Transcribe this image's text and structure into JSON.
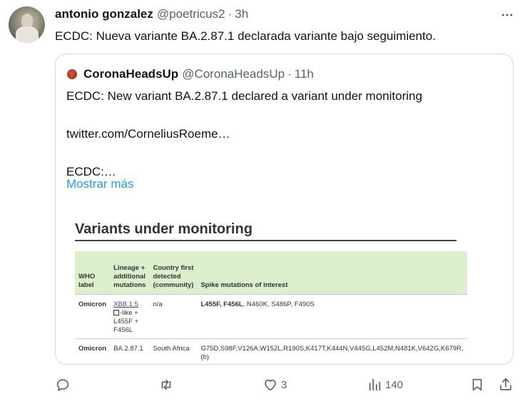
{
  "tweet": {
    "author_name": "antonio gonzalez",
    "author_handle": "@poetricus2",
    "separator": "·",
    "time": "3h",
    "text": "ECDC: Nueva variante BA.2.87.1 declarada variante bajo seguimiento."
  },
  "quoted": {
    "author_name": "CoronaHeadsUp",
    "author_handle": "@CoronaHeadsUp",
    "separator": "·",
    "time": "11h",
    "lines": [
      "ECDC: New variant BA.2.87.1 declared a variant under monitoring",
      "",
      "twitter.com/CorneliusRoeme…",
      "",
      "ECDC:…"
    ],
    "show_more": "Mostrar más",
    "media": {
      "title": "Variants under monitoring",
      "headers": [
        "WHO label",
        "Lineage + additional mutations",
        "Country first detected (community)",
        "Spike mutations of interest"
      ],
      "rows": [
        {
          "who": "Omicron",
          "lineage_link": "XBB.1.5",
          "lineage_rest": [
            "-like +",
            "L455F +",
            "F456L"
          ],
          "country": "n/a",
          "mutations_bold": "L455F, F456L",
          "mutations_rest": ", N460K, S486P, F490S"
        },
        {
          "who": "Omicron",
          "lineage": "BA.2.87.1",
          "country": "South Africa",
          "mutations": "G75D,S98F,V126A,W152L,R190S,K417T,K444N,V445G,L452M,N481K,V642G,K679R,",
          "note": "(b)"
        }
      ]
    }
  },
  "actions": {
    "reply": {
      "icon": "reply-icon",
      "count": ""
    },
    "retweet": {
      "icon": "retweet-icon",
      "count": ""
    },
    "like": {
      "icon": "heart-icon",
      "count": "3"
    },
    "views": {
      "icon": "views-icon",
      "count": "140"
    },
    "bookmark": {
      "icon": "bookmark-icon",
      "count": ""
    },
    "share": {
      "icon": "share-icon",
      "count": ""
    }
  },
  "colors": {
    "text": "#0f1419",
    "secondary": "#536471",
    "link": "#1d9bf0",
    "border": "#cfd9de",
    "table_header": "#dcefcc"
  }
}
